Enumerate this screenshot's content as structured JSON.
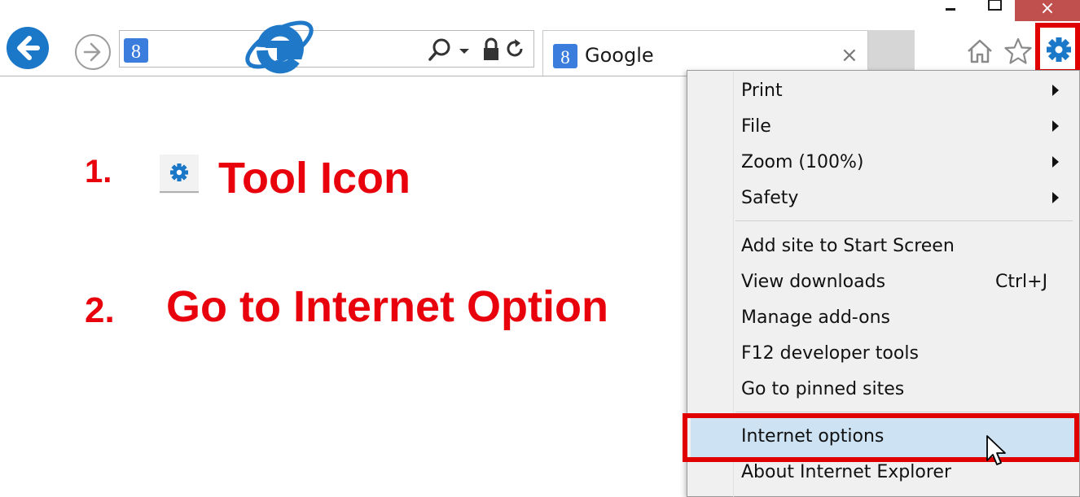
{
  "window": {
    "close_glyph": "×"
  },
  "toolbar": {
    "tab_title": "Google",
    "tab_close_glyph": "×"
  },
  "annotations": {
    "step1_number": "1.",
    "step1_text": "Tool Icon",
    "step2_number": "2.",
    "step2_text": "Go to Internet Option",
    "color": "#e8000c"
  },
  "menu": {
    "items": [
      {
        "label": "Print",
        "submenu": true
      },
      {
        "label": "File",
        "submenu": true
      },
      {
        "label": "Zoom (100%)",
        "submenu": true
      },
      {
        "label": "Safety",
        "submenu": true
      },
      {
        "label": "Add site to Start Screen"
      },
      {
        "label": "View downloads",
        "shortcut": "Ctrl+J"
      },
      {
        "label": "Manage add-ons"
      },
      {
        "label": "F12 developer tools"
      },
      {
        "label": "Go to pinned sites"
      },
      {
        "label": "Internet options",
        "highlighted": true
      },
      {
        "label": "About Internet Explorer"
      }
    ]
  },
  "icons": {
    "back": "back-arrow-icon",
    "forward": "forward-arrow-icon",
    "search": "search-icon",
    "lock": "lock-icon",
    "refresh": "refresh-icon",
    "home": "home-icon",
    "favorites": "star-icon",
    "tools": "gear-icon",
    "logo": "internet-explorer-logo"
  },
  "colors": {
    "accent_blue": "#1b77c7",
    "highlight_red": "#e00000",
    "menu_bg": "#f0f0f0",
    "hover_bg": "#cde2f3"
  }
}
